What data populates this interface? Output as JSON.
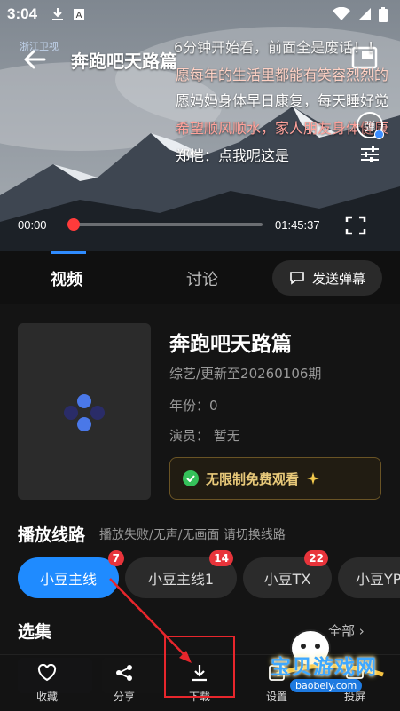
{
  "status_bar": {
    "time": "3:04"
  },
  "player": {
    "title": "奔跑吧天路篇",
    "channel_logo": "浙江卫视",
    "danmaku": [
      "6分钟开始看，前面全是废话！！",
      "愿每年的生活里都能有笑容烈烈的",
      "愿妈妈身体早日康复，每天睡好觉",
      "希望顺风顺水，家人朋友身体健康",
      "郑恺：点我呢这是"
    ],
    "danmaku_toggle_label": "弹",
    "current_time": "00:00",
    "total_time": "01:45:37",
    "progress_fraction": 0
  },
  "tabs": {
    "video": "视频",
    "discuss": "讨论",
    "send_danmaku": "发送弹幕"
  },
  "info": {
    "title": "奔跑吧天路篇",
    "category": "综艺/更新至20260106期",
    "year": "年份：0",
    "cast": "演员：  暂无",
    "free_badge": "无限制免费观看"
  },
  "lines": {
    "heading": "播放线路",
    "hint": "播放失败/无声/无画面 请切换线路",
    "items": [
      {
        "label": "小豆主线",
        "badge": "7"
      },
      {
        "label": "小豆主线1",
        "badge": "14"
      },
      {
        "label": "小豆TX",
        "badge": "22"
      },
      {
        "label": "小豆YP",
        "badge": ""
      }
    ]
  },
  "episodes": {
    "heading": "选集",
    "all": "全部"
  },
  "bottom_bar": {
    "favorite": "收藏",
    "share": "分享",
    "download": "下载",
    "settings": "设置",
    "cast": "投屏"
  },
  "watermark": {
    "text": "宝贝游戏网",
    "url": "baobeiy.com"
  },
  "colors": {
    "accent": "#1f8bff",
    "badge": "#e8343b",
    "progress": "#ff3b3b",
    "free": "#e8c97a"
  }
}
